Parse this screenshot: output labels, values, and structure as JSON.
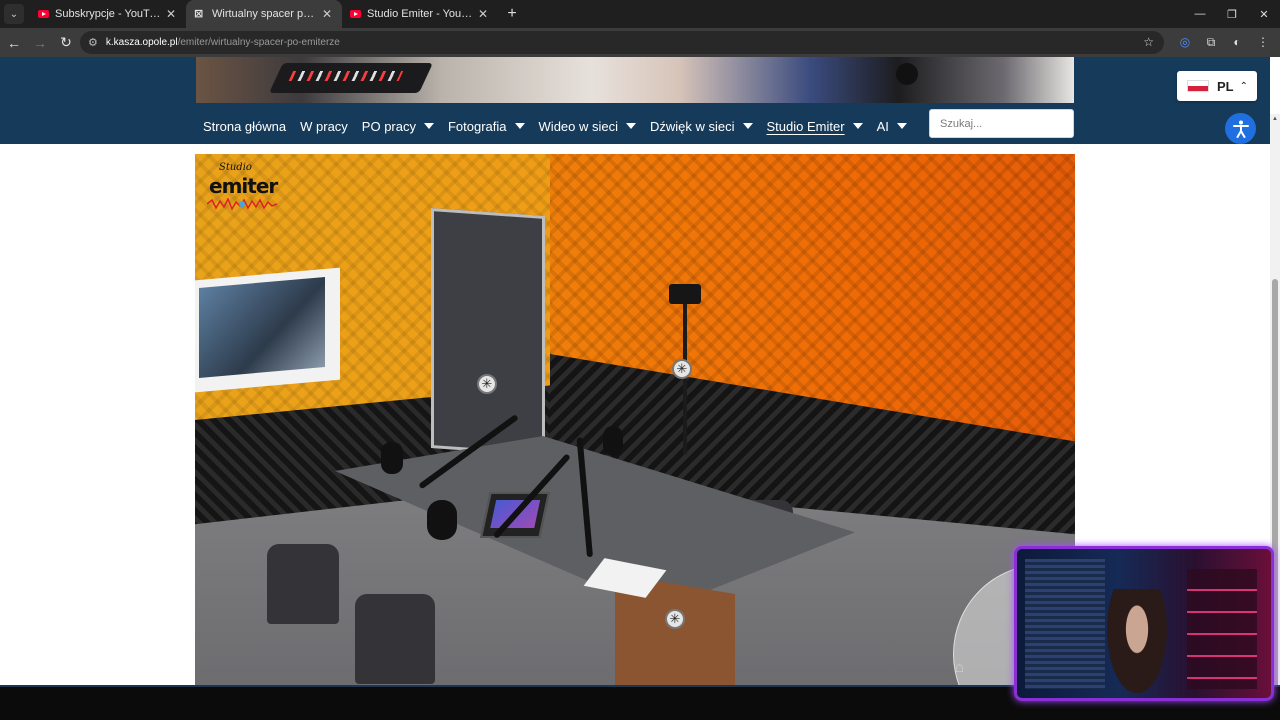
{
  "browser": {
    "tabs": [
      {
        "title": "Subskrypcje - YouTube",
        "favicon": "youtube-icon",
        "active": false
      },
      {
        "title": "Wirtualny spacer po \"Emiterze\"",
        "favicon": "site-w-icon",
        "active": true
      },
      {
        "title": "Studio Emiter - YouTube",
        "favicon": "youtube-icon",
        "active": false
      }
    ],
    "url_host": "k.kasza.opole.pl",
    "url_path": "/emiter/wirtualny-spacer-po-emiterze"
  },
  "site": {
    "nav": [
      {
        "label": "Strona główna",
        "dropdown": false
      },
      {
        "label": "W pracy",
        "dropdown": false
      },
      {
        "label": "PO pracy",
        "dropdown": true
      },
      {
        "label": "Fotografia",
        "dropdown": true
      },
      {
        "label": "Wideo w sieci",
        "dropdown": true
      },
      {
        "label": "Dźwięk w sieci",
        "dropdown": true
      },
      {
        "label": "Studio Emiter",
        "dropdown": true,
        "current": true
      },
      {
        "label": "AI",
        "dropdown": true
      }
    ],
    "search_placeholder": "Szukaj...",
    "language": {
      "code": "PL",
      "flag": "poland-flag"
    },
    "header_color": "#163b5a",
    "accent": "#1f6fe0"
  },
  "panorama": {
    "logo": {
      "line1": "Studio",
      "line2": "emiter"
    }
  }
}
